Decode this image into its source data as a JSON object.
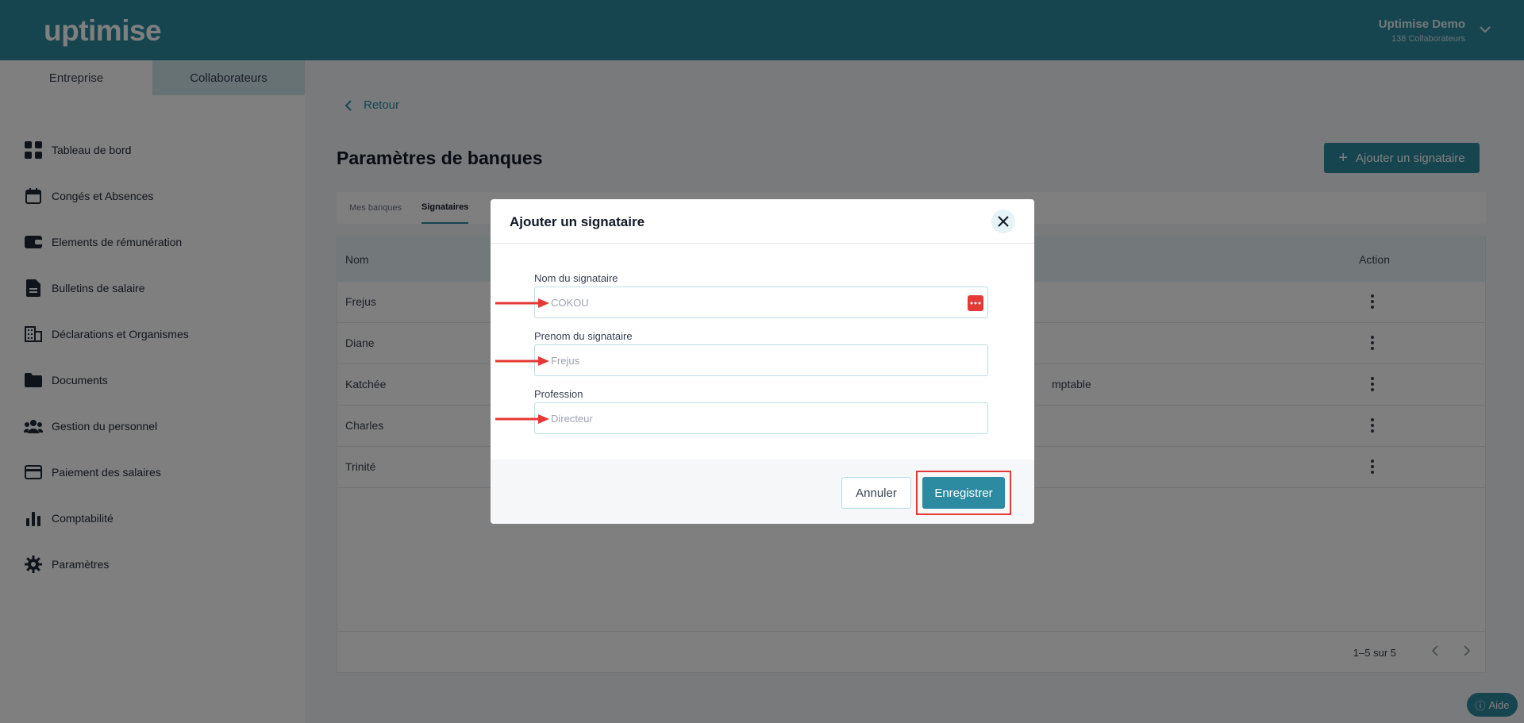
{
  "header": {
    "logo": "uptimise",
    "user_name": "Uptimise Demo",
    "user_sub": "138 Collaborateurs"
  },
  "sidebar": {
    "tabs": [
      {
        "label": "Entreprise",
        "active": false
      },
      {
        "label": "Collaborateurs",
        "active": true
      }
    ],
    "items": [
      {
        "label": "Tableau de bord",
        "icon": "dashboard-icon"
      },
      {
        "label": "Congés et Absences",
        "icon": "calendar-icon"
      },
      {
        "label": "Elements de rémunération",
        "icon": "wallet-icon"
      },
      {
        "label": "Bulletins de salaire",
        "icon": "document-icon"
      },
      {
        "label": "Déclarations et Organismes",
        "icon": "building-icon"
      },
      {
        "label": "Documents",
        "icon": "folder-icon"
      },
      {
        "label": "Gestion du personnel",
        "icon": "people-icon"
      },
      {
        "label": "Paiement des salaires",
        "icon": "card-icon"
      },
      {
        "label": "Comptabilité",
        "icon": "bar-chart-icon"
      },
      {
        "label": "Paramètres",
        "icon": "gear-icon"
      }
    ]
  },
  "main": {
    "back_label": "Retour",
    "title": "Paramètres de banques",
    "add_button": "Ajouter un signataire",
    "tabs": [
      "Mes banques",
      "Signataires"
    ],
    "active_tab": "Signataires",
    "table": {
      "columns": [
        "Nom",
        "Action"
      ],
      "rows": [
        {
          "name": "Frejus",
          "extra": ""
        },
        {
          "name": "Diane",
          "extra": ""
        },
        {
          "name": "Katchée",
          "extra": "mptable"
        },
        {
          "name": "Charles",
          "extra": ""
        },
        {
          "name": "Trinité",
          "extra": ""
        }
      ]
    },
    "pagination": "1–5 sur 5",
    "help_label": "Aide"
  },
  "modal": {
    "title": "Ajouter un signataire",
    "fields": [
      {
        "label": "Nom du signataire",
        "value": "COKOU"
      },
      {
        "label": "Prenom du signataire",
        "value": "Frejus"
      },
      {
        "label": "Profession",
        "value": "Directeur"
      }
    ],
    "cancel": "Annuler",
    "save": "Enregistrer"
  },
  "colors": {
    "brand": "#2c8ba0",
    "annotation": "#e53935"
  }
}
